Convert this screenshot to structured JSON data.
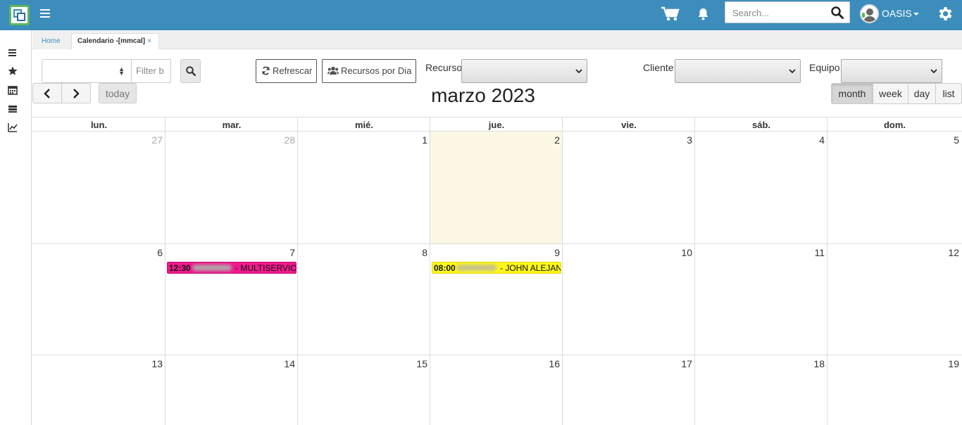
{
  "header": {
    "search_placeholder": "Search...",
    "user_name": "OASIS",
    "icons": [
      "logo",
      "menu-icon",
      "cart-icon",
      "bell-icon",
      "search-icon",
      "avatar",
      "gear-icon"
    ]
  },
  "sidebar": {
    "icons": [
      "menu-icon",
      "star-icon",
      "calendar-icon",
      "server-icon",
      "chart-line-icon"
    ]
  },
  "tabs": [
    {
      "label": "Home"
    },
    {
      "label": "Calendario -[mmcal]",
      "close": "×"
    }
  ],
  "filters": {
    "filter_placeholder": "Filter b",
    "refresh_label": "Refrescar",
    "recursos_label": "Recursos por Dia",
    "recurso_label": "Recurso:",
    "cliente_label": "Cliente:",
    "equipo_label": "Equipo:"
  },
  "calendar": {
    "title": "marzo 2023",
    "today_label": "today",
    "views": [
      "month",
      "week",
      "day",
      "list"
    ],
    "active_view": "month",
    "days_of_week": [
      "lun.",
      "mar.",
      "mié.",
      "jue.",
      "vie.",
      "sáb.",
      "dom."
    ],
    "weeks": [
      [
        "27",
        "28",
        "1",
        "2",
        "3",
        "4",
        "5"
      ],
      [
        "6",
        "7",
        "8",
        "9",
        "10",
        "11",
        "12"
      ],
      [
        "13",
        "14",
        "15",
        "16",
        "17",
        "18",
        "19"
      ]
    ],
    "events": [
      {
        "time": "12:30",
        "title": " - MULTISERVICIO",
        "color": "#f0198c"
      },
      {
        "time": "08:00",
        "title": " - JOHN ALEJANDRO",
        "color": "#fbf71c"
      }
    ],
    "today_color": "#fcf8e3"
  },
  "colors": {
    "topbar": "#3c8dbc",
    "logo_border": "#5cb85c"
  }
}
